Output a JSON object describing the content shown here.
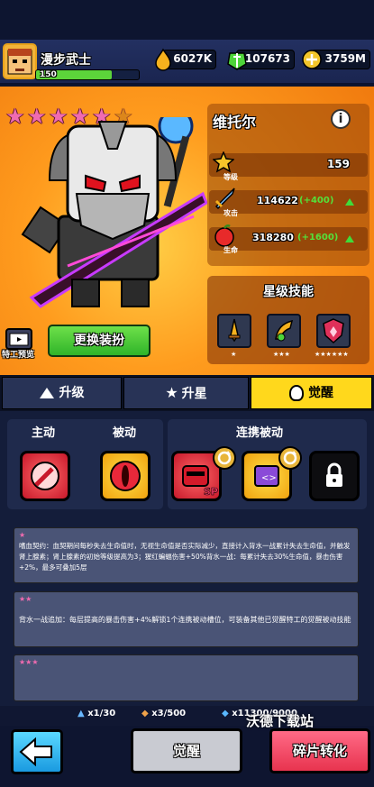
{
  "player": {
    "name": "漫步武士",
    "level": "150",
    "level_progress": 0.74
  },
  "resources": [
    {
      "icon": "flame-coin-icon",
      "value": "6027K"
    },
    {
      "icon": "green-gem-icon",
      "value": "107673"
    },
    {
      "icon": "gold-gem-icon",
      "value": "3759M"
    }
  ],
  "hero": {
    "name": "维托尔",
    "stars": 5,
    "max_stars": 6,
    "level_label": "等级",
    "level": "159",
    "attack_label": "攻击",
    "attack": "114622",
    "attack_bonus": "(+400)",
    "hp_label": "生命",
    "hp": "318280",
    "hp_bonus": "(+1600)"
  },
  "star_skills": {
    "title": "星级技能",
    "slots": [
      {
        "icon": "dagger-icon",
        "stars": "★"
      },
      {
        "icon": "horn-icon",
        "stars": "★★★"
      },
      {
        "icon": "shield-icon",
        "stars": "★★★★★★"
      }
    ]
  },
  "buttons": {
    "change_outfit": "更换装扮",
    "preview": "特工预览",
    "awaken": "觉醒",
    "shard_convert": "碎片转化"
  },
  "tabs": [
    {
      "label": "升级"
    },
    {
      "label": "升星"
    },
    {
      "label": "觉醒"
    }
  ],
  "skill_sections": {
    "active": "主动",
    "passive": "被动",
    "link_passive": "连携被动"
  },
  "descriptions": [
    {
      "stars": "★",
      "text": "嗜血契约：血契期间每秒失去生命值时，无视生命值是否实际减少，直接计入背水一战累计失去生命值，并触发肾上腺素；肾上腺素的初始等级提高为3；猩红蝙蝠伤害+50%背水一战：每累计失去30%生命值，暴击伤害+2%，最多可叠加5层"
    },
    {
      "stars": "★★",
      "text": "背水一战追加：每层提高的暴击伤害+4%解锁1个连携被动槽位，可装备其他已觉醒特工的觉醒被动技能"
    },
    {
      "stars": "★★★",
      "text": ""
    }
  ],
  "materials": [
    {
      "icon": "triangle-badge-icon",
      "value": "x1/30"
    },
    {
      "icon": "orange-badge-icon",
      "value": "x3/500"
    },
    {
      "icon": "blue-badge-icon",
      "value": "x11300/9000"
    }
  ],
  "watermark": "沃德下载站",
  "colors": {
    "accent_yellow": "#ffd81c",
    "star_pink": "#f06bb0",
    "bonus_green": "#55e03a",
    "panel_dark": "#1f2a4c"
  }
}
